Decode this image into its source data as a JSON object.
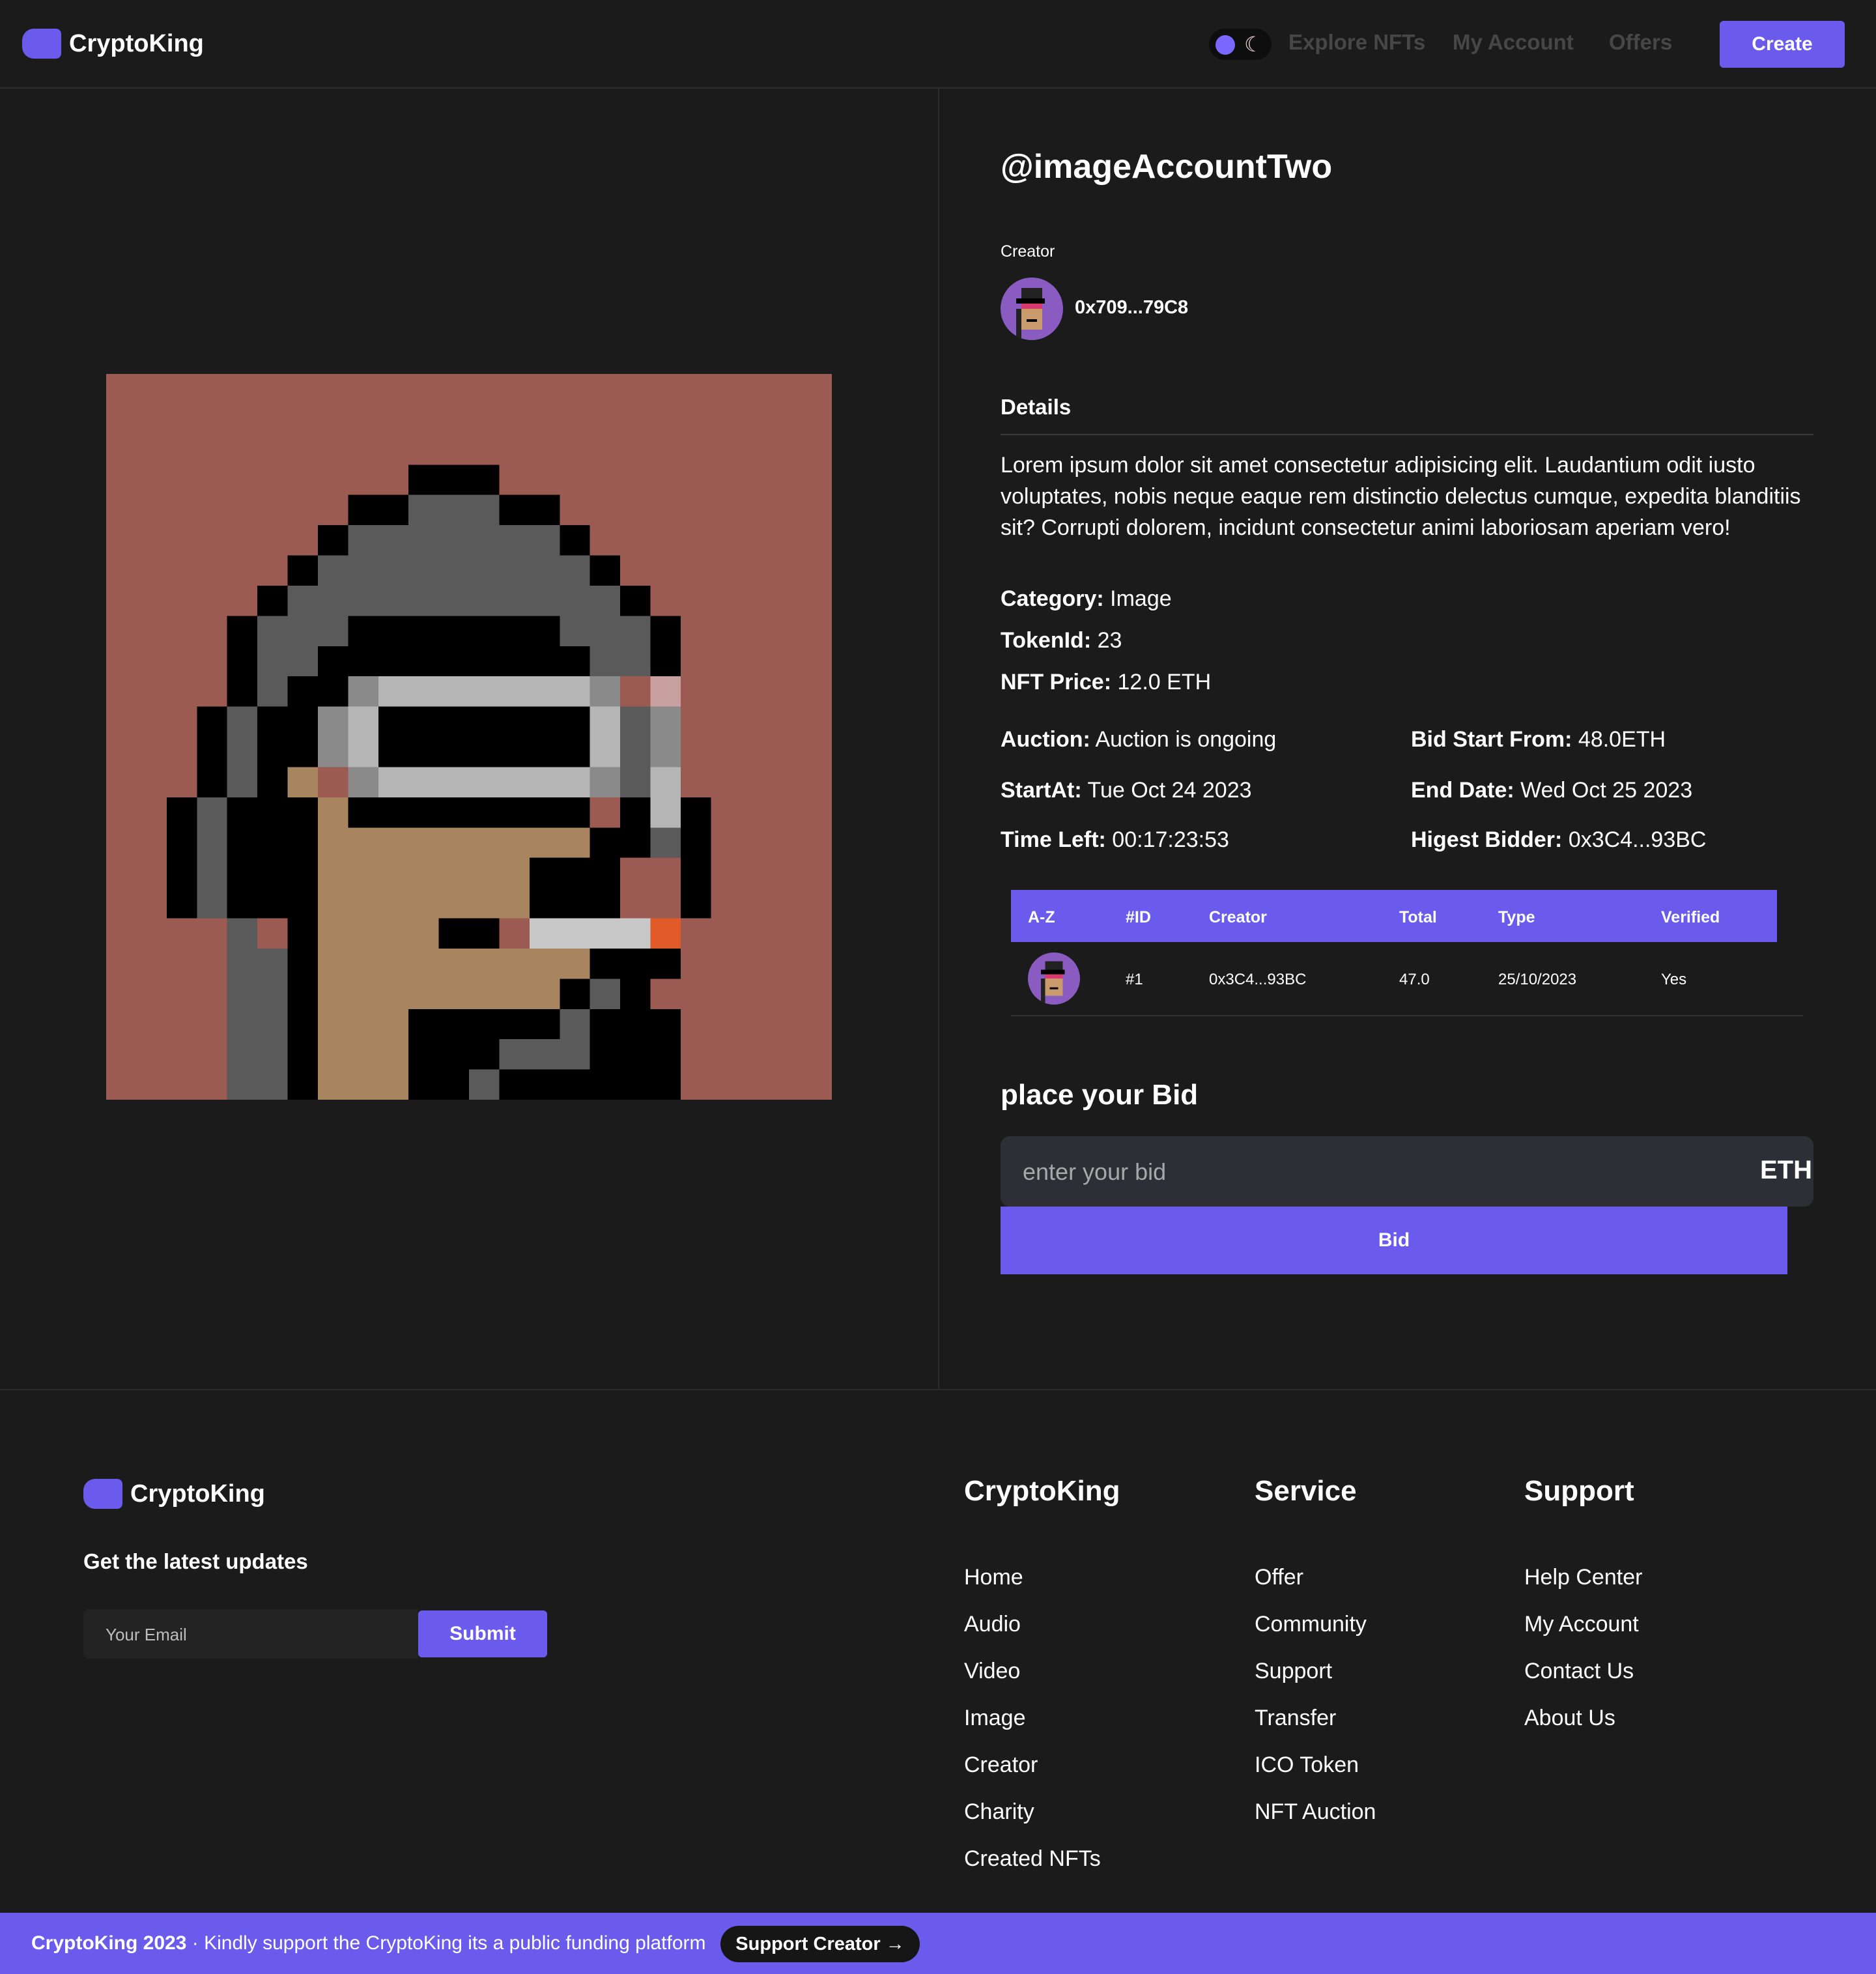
{
  "brand": {
    "name": "CryptoKing",
    "accent": "#6b5bed"
  },
  "nav": {
    "links": [
      "Explore NFTs",
      "My Account",
      "Offers"
    ],
    "create_label": "Create",
    "theme_toggle_icon": "moon-icon"
  },
  "nft": {
    "handle": "@imageAccountTwo",
    "creator_label": "Creator",
    "creator_address": "0x709...79C8",
    "details_heading": "Details",
    "description": "Lorem ipsum dolor sit amet consectetur adipisicing elit. Laudantium odit iusto voluptates, nobis neque eaque rem distinctio delectus cumque, expedita blanditiis sit? Corrupti dolorem, incidunt consectetur animi laboriosam aperiam vero!",
    "category_label": "Category:",
    "category": "Image",
    "tokenid_label": "TokenId:",
    "tokenid": "23",
    "price_label": "NFT Price:",
    "price": "12.0 ETH",
    "auction_label": "Auction:",
    "auction": "Auction is ongoing",
    "bid_start_label": "Bid Start From:",
    "bid_start": "48.0ETH",
    "start_label": "StartAt:",
    "start": "Tue Oct 24 2023",
    "end_label": "End Date:",
    "end": "Wed Oct 25 2023",
    "timeleft_label": "Time Left:",
    "timeleft": "00:17:23:53",
    "highest_label": "Higest Bidder:",
    "highest": "0x3C4...93BC"
  },
  "bids_table": {
    "headers": [
      "A-Z",
      "#ID",
      "Creator",
      "Total",
      "Type",
      "Verified"
    ],
    "rows": [
      {
        "id": "#1",
        "creator": "0x3C4...93BC",
        "total": "47.0",
        "type": "25/10/2023",
        "verified": "Yes"
      }
    ]
  },
  "bid_form": {
    "heading": "place your Bid",
    "placeholder": "enter your bid",
    "unit": "ETH",
    "button": "Bid"
  },
  "footer": {
    "updates": "Get the latest updates",
    "email_placeholder": "Your Email",
    "submit": "Submit",
    "columns": [
      {
        "title": "CryptoKing",
        "links": [
          "Home",
          "Audio",
          "Video",
          "Image",
          "Creator",
          "Charity",
          "Created NFTs"
        ]
      },
      {
        "title": "Service",
        "links": [
          "Offer",
          "Community",
          "Support",
          "Transfer",
          "ICO Token",
          "NFT Auction"
        ]
      },
      {
        "title": "Support",
        "links": [
          "Help Center",
          "My Account",
          "Contact Us",
          "About Us"
        ]
      }
    ],
    "bottom_brand": "CryptoKing 2023",
    "bottom_sep": "·",
    "bottom_text": "Kindly support the CryptoKing its a public funding platform",
    "support_button": "Support Creator →"
  }
}
